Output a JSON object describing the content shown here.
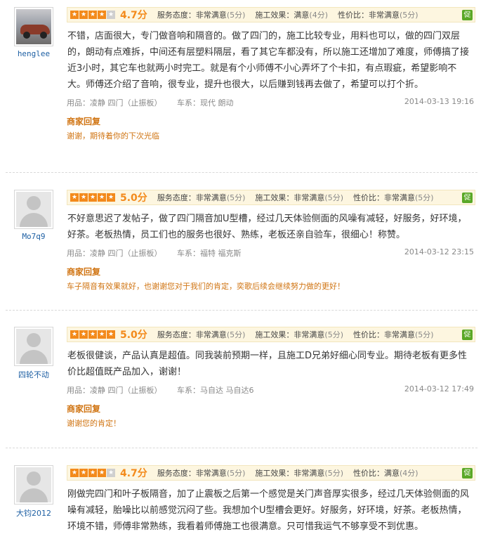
{
  "labels": {
    "service": "服务态度：",
    "construction": "施工效果：",
    "value": "性价比：",
    "product": "用品：",
    "car": "车系：",
    "reply_title": "商家回复",
    "badge": "促"
  },
  "reviews": [
    {
      "user": "henglee",
      "score": "4.7分",
      "stars": 4,
      "service": "非常满意",
      "service_pts": "(5分)",
      "construction": "满意",
      "construction_pts": "(4分)",
      "value": "非常满意",
      "value_pts": "(5分)",
      "text": "不错，店面很大，专门做音响和隔音的。做了四门的，施工比较专业，用料也可以，做的四门双层的，朗动有点难拆，中间还有层塑料隔层，看了其它车都没有，所以施工还增加了难度，师傅搞了接近3小时，其它车也就两小时完工。就是有个小师傅不小心弄坏了个卡扣，有点瑕疵，希望影响不大。师傅还介绍了音响，很专业，提升也很大，以后赚到钱再去做了，希望可以打个折。",
      "product": "凌静  四门（止振板）",
      "car": "现代  朗动",
      "date": "2014-03-13  19:16",
      "reply": "谢谢，期待着你的下次光临"
    },
    {
      "user": "Mo7q9",
      "score": "5.0分",
      "stars": 5,
      "service": "非常满意",
      "service_pts": "(5分)",
      "construction": "非常满意",
      "construction_pts": "(5分)",
      "value": "非常满意",
      "value_pts": "(5分)",
      "text": "不好意思迟了发帖子，做了四门隔音加U型槽，经过几天体验侧面的风噪有减轻，好服务，好环境，好茶。老板热情，员工们也的服务也很好、熟练，老板还亲自验车，很细心！称赞。",
      "product": "凌静  四门（止振板）",
      "car": "福特  福克斯",
      "date": "2014-03-12  23:15",
      "reply": "车子隔音有效果就好，也谢谢您对于我们的肯定，奕歌后续会继续努力做的更好！"
    },
    {
      "user": "四轮不动",
      "score": "5.0分",
      "stars": 5,
      "service": "非常满意",
      "service_pts": "(5分)",
      "construction": "非常满意",
      "construction_pts": "(5分)",
      "value": "非常满意",
      "value_pts": "(5分)",
      "text": "老板很健谈，产品认真是超值。同我装前预期一样，且施工D兄弟好细心同专业。期待老板有更多性价比超值既产品加入，谢谢！",
      "product": "凌静  四门（止振板）",
      "car": "马自达  马自达6",
      "date": "2014-03-12  17:49",
      "reply": "谢谢您的肯定！"
    },
    {
      "user": "大钧2012",
      "score": "4.7分",
      "stars": 4,
      "service": "非常满意",
      "service_pts": "(5分)",
      "construction": "非常满意",
      "construction_pts": "(5分)",
      "value": "满意",
      "value_pts": "(4分)",
      "text": "刚做完四门和叶子板隔音，加了止震板之后第一个感觉是关门声音厚实很多，经过几天体验侧面的风噪有减轻，胎噪比以前感觉沉闷了些。我想加个U型槽会更好。好服务，好环境，好茶。老板热情，环境不错，师傅非常熟练，我看着师傅施工也很满意。只可惜我运气不够享受不到优惠。",
      "product": "",
      "car": "",
      "date": "",
      "reply": ""
    }
  ]
}
